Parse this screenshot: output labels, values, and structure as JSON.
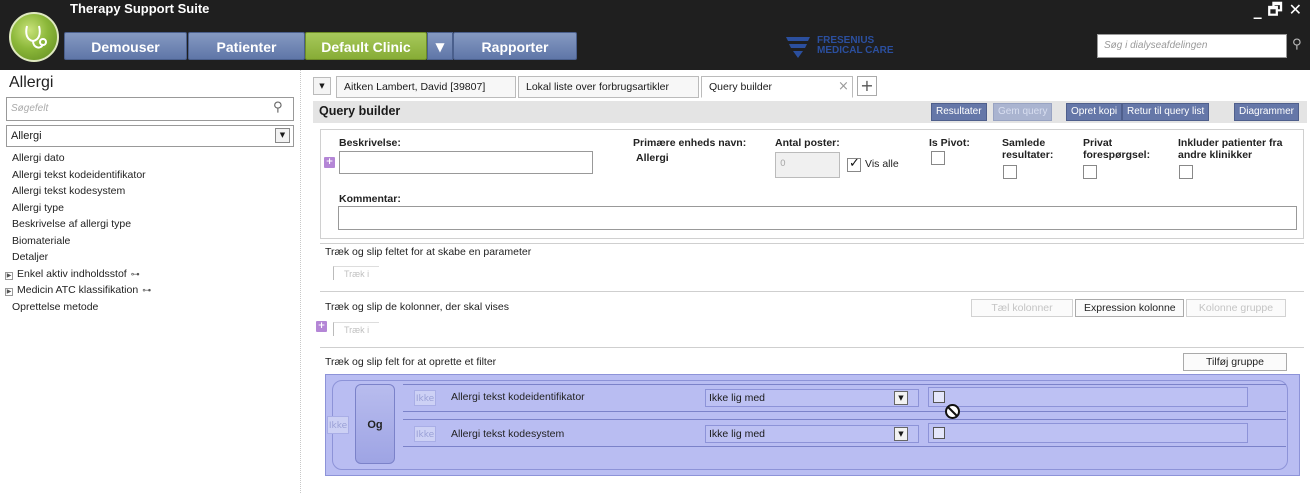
{
  "app": {
    "title": "Therapy Support Suite"
  },
  "window_controls": {
    "minimize": "_",
    "restore": "🗗",
    "close": "✕"
  },
  "topnav": {
    "demouser": "Demouser",
    "patienter": "Patienter",
    "clinic": "Default Clinic",
    "clinic_arrow": "▼",
    "rapporter": "Rapporter",
    "brand_line1": "FRESENIUS",
    "brand_line2": "MEDICAL CARE",
    "search_placeholder": "Søg i dialyseafdelingen"
  },
  "left": {
    "title": "Allergi",
    "search_placeholder": "Søgefelt",
    "select_value": "Allergi",
    "tree": [
      {
        "label": "Allergi dato"
      },
      {
        "label": "Allergi tekst kodeidentifikator"
      },
      {
        "label": "Allergi tekst kodesystem"
      },
      {
        "label": "Allergi type"
      },
      {
        "label": "Beskrivelse af allergi type"
      },
      {
        "label": "Biomateriale"
      },
      {
        "label": "Detaljer"
      },
      {
        "label": "Enkel aktiv indholdsstof"
      },
      {
        "label": "Medicin ATC klassifikation"
      },
      {
        "label": "Oprettelse metode"
      }
    ],
    "link_glyph": "⊶"
  },
  "tabs": [
    {
      "label": "Aitken Lambert, David [39807]"
    },
    {
      "label": "Lokal liste over forbrugsartikler"
    },
    {
      "label": "Query builder"
    }
  ],
  "tab_close": "×",
  "tab_add": "+",
  "query_builder": {
    "title": "Query builder",
    "buttons": {
      "resultater": "Resultater",
      "gem_query": "Gem query",
      "opret_kopi": "Opret kopi",
      "retur": "Retur til query list",
      "diagrammer": "Diagrammer"
    },
    "form": {
      "beskrivelse_label": "Beskrivelse:",
      "primary_entity_label": "Primære enheds navn:",
      "primary_entity_value": "Allergi",
      "antal_label": "Antal poster:",
      "antal_value": "0",
      "vis_alle_label": "Vis alle",
      "vis_alle_checked": true,
      "is_pivot_label": "Is Pivot:",
      "samlede_label_1": "Samlede",
      "samlede_label_2": "resultater:",
      "privat_label_1": "Privat",
      "privat_label_2": "forespørgsel:",
      "inkluder_label_1": "Inkluder patienter fra",
      "inkluder_label_2": "andre klinikker",
      "kommentar_label": "Kommentar:"
    },
    "param_section": {
      "label": "Træk og slip feltet for at skabe en parameter",
      "chip": "Træk i"
    },
    "columns_section": {
      "label": "Træk og slip de kolonner, der skal vises",
      "chip": "Træk i",
      "btn_tael": "Tæl kolonner",
      "btn_expression": "Expression kolonne",
      "btn_gruppe": "Kolonne gruppe"
    },
    "filter_section": {
      "label": "Træk og slip felt for at oprette et filter",
      "btn_tilfoej": "Tilføj gruppe",
      "outer_ikke": "Ikke",
      "og": "Og",
      "rows": [
        {
          "ikke": "Ikke",
          "field": "Allergi tekst kodeidentifikator",
          "operator": "Ikke lig med"
        },
        {
          "ikke": "Ikke",
          "field": "Allergi tekst kodesystem",
          "operator": "Ikke lig med"
        }
      ]
    }
  },
  "colors": {
    "topbar": "#1f1f1f",
    "nav_blue": "#6a80b2",
    "nav_green": "#8fb23c",
    "button_blue": "#6577a8",
    "filter_bg": "#b9bdf2",
    "brand_blue": "#2b4f9e"
  },
  "icons": {
    "logo": "stethoscope-logo",
    "search": "search-icon",
    "dropdown": "chevron-down-icon",
    "no_drop": "no-drop-cursor-icon"
  }
}
